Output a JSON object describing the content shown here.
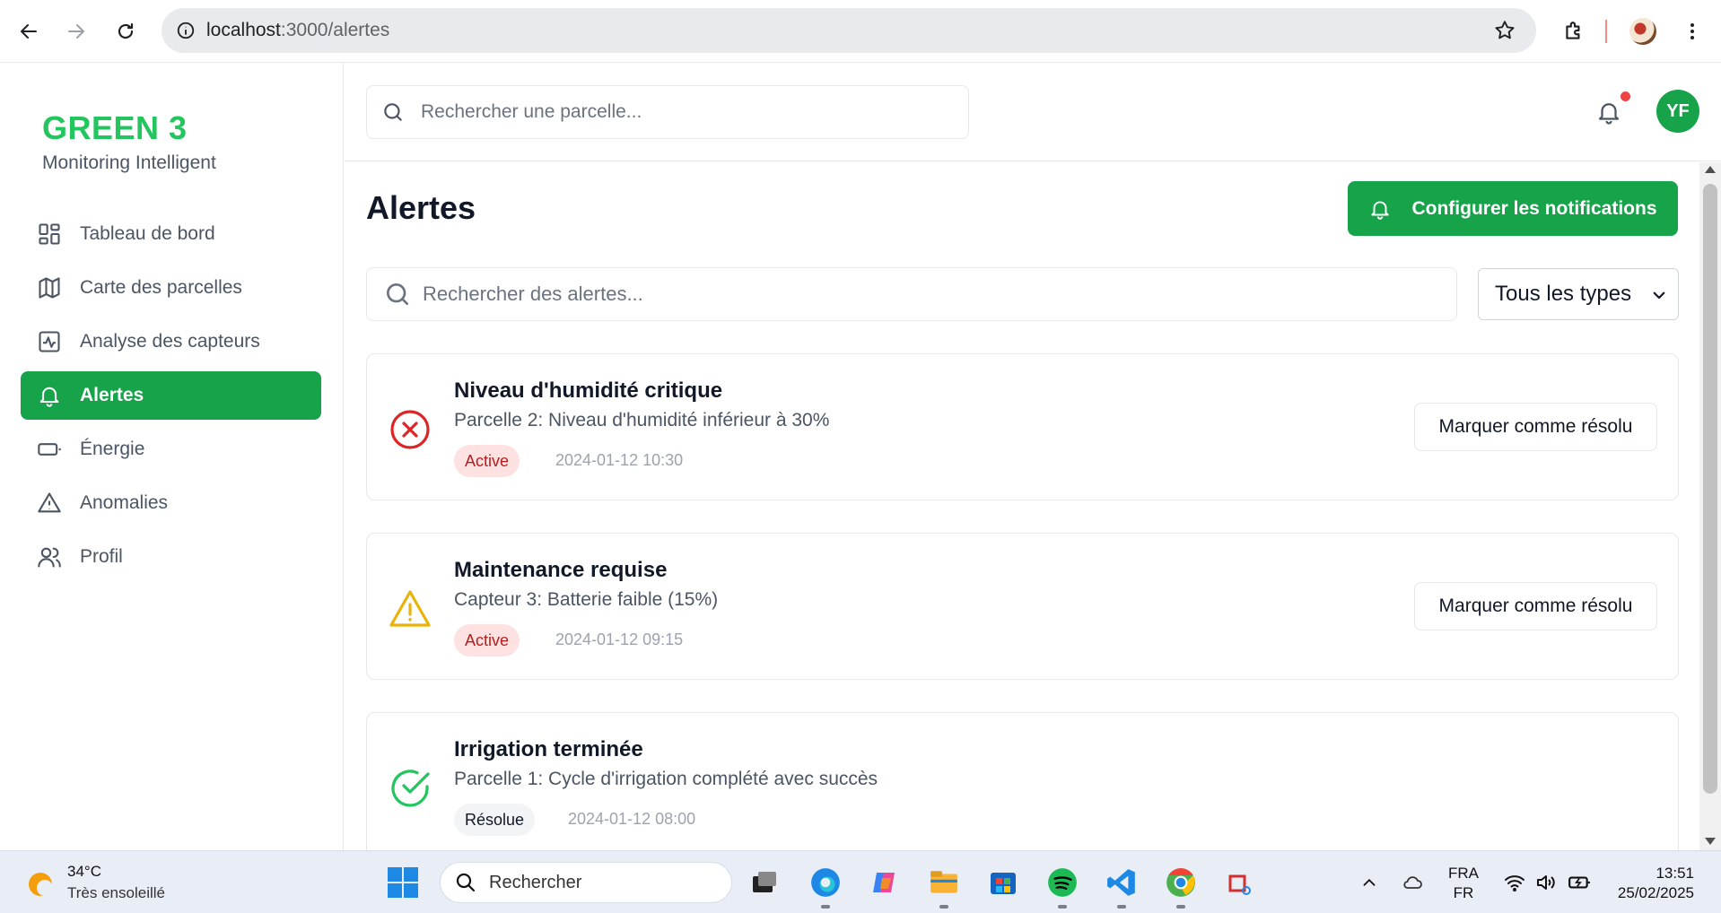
{
  "browser": {
    "url_host": "localhost",
    "url_path": ":3000/alertes"
  },
  "sidebar": {
    "brand": "GREEN 3",
    "subtitle": "Monitoring Intelligent",
    "items": [
      {
        "label": "Tableau de bord",
        "icon": "dashboard-icon"
      },
      {
        "label": "Carte des parcelles",
        "icon": "map-icon"
      },
      {
        "label": "Analyse des capteurs",
        "icon": "activity-icon"
      },
      {
        "label": "Alertes",
        "icon": "bell-icon"
      },
      {
        "label": "Énergie",
        "icon": "battery-icon"
      },
      {
        "label": "Anomalies",
        "icon": "warning-icon"
      },
      {
        "label": "Profil",
        "icon": "users-icon"
      }
    ],
    "active_item": "Alertes"
  },
  "topbar": {
    "search_placeholder": "Rechercher une parcelle...",
    "avatar_initials": "YF"
  },
  "main": {
    "title": "Alertes",
    "configure_button": "Configurer les notifications",
    "search_placeholder": "Rechercher des alertes...",
    "type_filter": "Tous les types",
    "alerts": [
      {
        "title": "Niveau d'humidité critique",
        "description": "Parcelle 2: Niveau d'humidité inférieur à 30%",
        "status": "Active",
        "timestamp": "2024-01-12 10:30",
        "action": "Marquer comme résolu",
        "icon": "error-circle-icon"
      },
      {
        "title": "Maintenance requise",
        "description": "Capteur 3: Batterie faible (15%)",
        "status": "Active",
        "timestamp": "2024-01-12 09:15",
        "action": "Marquer comme résolu",
        "icon": "warning-triangle-icon"
      },
      {
        "title": "Irrigation terminée",
        "description": "Parcelle 1: Cycle d'irrigation complété avec succès",
        "status": "Résolue",
        "timestamp": "2024-01-12 08:00",
        "icon": "check-circle-icon"
      }
    ]
  },
  "taskbar": {
    "weather_temp": "34°C",
    "weather_desc": "Très ensoleillé",
    "search_placeholder": "Rechercher",
    "lang_top": "FRA",
    "lang_bottom": "FR",
    "time": "13:51",
    "date": "25/02/2025"
  },
  "colors": {
    "brand_green": "#16a34a",
    "brand_text_green": "#22c55e",
    "danger": "#dc2626",
    "warning": "#eab308",
    "success": "#22c55e"
  }
}
